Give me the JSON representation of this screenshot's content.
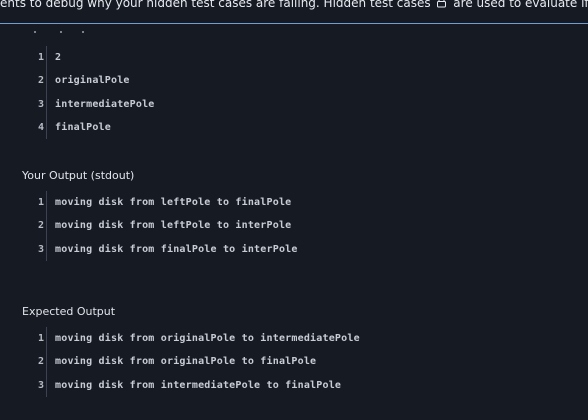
{
  "banner": {
    "text_before": "ents to debug why your hidden test cases are failing. Hidden test cases",
    "text_after": "are used to evaluate if your code can m"
  },
  "input": {
    "lines": [
      {
        "num": "1",
        "text": "2"
      },
      {
        "num": "2",
        "text": "originalPole"
      },
      {
        "num": "3",
        "text": "intermediatePole"
      },
      {
        "num": "4",
        "text": "finalPole"
      }
    ]
  },
  "your_output": {
    "label": "Your Output (stdout)",
    "lines": [
      {
        "num": "1",
        "text": "moving disk from leftPole to finalPole"
      },
      {
        "num": "2",
        "text": "moving disk from leftPole to interPole"
      },
      {
        "num": "3",
        "text": "moving disk from finalPole to interPole"
      }
    ]
  },
  "expected_output": {
    "label": "Expected Output",
    "lines": [
      {
        "num": "1",
        "text": "moving disk from originalPole to intermediatePole"
      },
      {
        "num": "2",
        "text": "moving disk from originalPole to finalPole"
      },
      {
        "num": "3",
        "text": "moving disk from intermediatePole to finalPole"
      }
    ]
  }
}
